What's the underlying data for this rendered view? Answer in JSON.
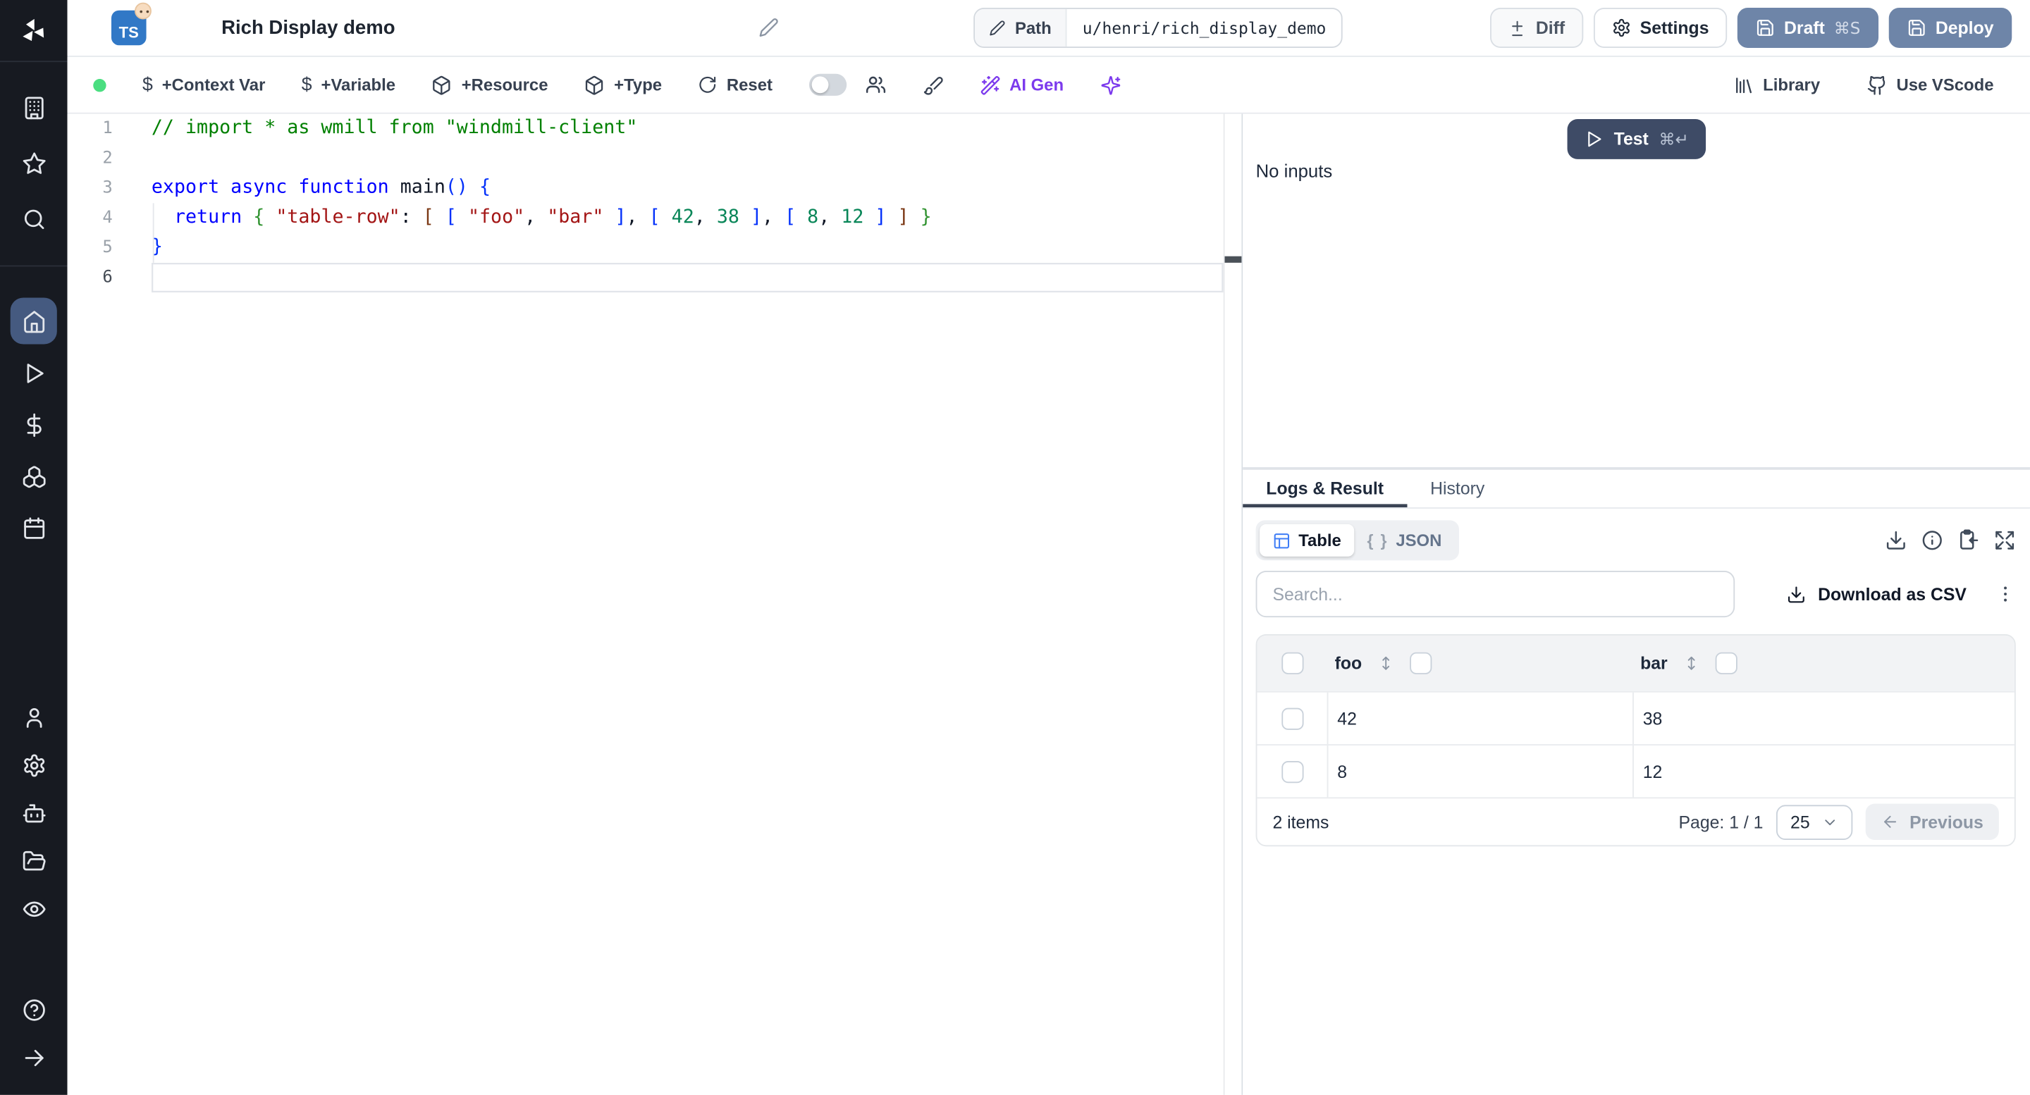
{
  "colors": {
    "sidebar_bg": "#171a21",
    "active_item": "#455a80",
    "primary_button": "#6e85a8",
    "test_button": "#3e4b66",
    "status_dot": "#4ade80",
    "ai_accent": "#7c3aed",
    "ts_badge": "#3178c6",
    "table_icon": "#3f7df6"
  },
  "sidebar": {
    "icons_top": [
      "workspace-building",
      "favorites-star",
      "search"
    ],
    "icons_main": [
      "home",
      "runs-play",
      "variables-dollar",
      "resources-boxes",
      "schedules-calendar"
    ],
    "icons_admin": [
      "user",
      "settings-gear",
      "workers-bot",
      "folders",
      "audit-eye"
    ],
    "icons_bottom": [
      "help-circle",
      "expand-arrow-right"
    ],
    "active": "home"
  },
  "header": {
    "language_badge": "TS",
    "title": "Rich Display demo",
    "path": {
      "label": "Path",
      "value": "u/henri/rich_display_demo"
    },
    "buttons": {
      "diff": "Diff",
      "settings": "Settings",
      "draft": "Draft",
      "draft_kbd": "⌘S",
      "deploy": "Deploy"
    }
  },
  "toolbar": {
    "context_var": "+Context Var",
    "variable": "+Variable",
    "resource": "+Resource",
    "type": "+Type",
    "reset": "Reset",
    "ai_gen": "AI Gen",
    "library": "Library",
    "vscode": "Use VScode"
  },
  "editor": {
    "current_line": 6,
    "lines": [
      {
        "tokens": [
          {
            "t": "// import * as wmill from \"windmill-client\"",
            "c": "comment"
          }
        ]
      },
      {
        "tokens": []
      },
      {
        "tokens": [
          {
            "t": "export",
            "c": "kw"
          },
          {
            "t": " ",
            "c": "pl"
          },
          {
            "t": "async",
            "c": "kw"
          },
          {
            "t": " ",
            "c": "pl"
          },
          {
            "t": "function",
            "c": "kw"
          },
          {
            "t": " ",
            "c": "pl"
          },
          {
            "t": "main",
            "c": "fn"
          },
          {
            "t": "(",
            "c": "b1"
          },
          {
            "t": ")",
            "c": "b1"
          },
          {
            "t": " ",
            "c": "pl"
          },
          {
            "t": "{",
            "c": "b1"
          }
        ]
      },
      {
        "tokens": [
          {
            "t": "  ",
            "c": "pl"
          },
          {
            "t": "return",
            "c": "kw"
          },
          {
            "t": " ",
            "c": "pl"
          },
          {
            "t": "{",
            "c": "b2"
          },
          {
            "t": " ",
            "c": "pl"
          },
          {
            "t": "\"table-row\"",
            "c": "str"
          },
          {
            "t": ": ",
            "c": "pl"
          },
          {
            "t": "[",
            "c": "b3"
          },
          {
            "t": " ",
            "c": "pl"
          },
          {
            "t": "[",
            "c": "b1"
          },
          {
            "t": " ",
            "c": "pl"
          },
          {
            "t": "\"foo\"",
            "c": "str"
          },
          {
            "t": ", ",
            "c": "pl"
          },
          {
            "t": "\"bar\"",
            "c": "str"
          },
          {
            "t": " ",
            "c": "pl"
          },
          {
            "t": "]",
            "c": "b1"
          },
          {
            "t": ", ",
            "c": "pl"
          },
          {
            "t": "[",
            "c": "b1"
          },
          {
            "t": " ",
            "c": "pl"
          },
          {
            "t": "42",
            "c": "num"
          },
          {
            "t": ", ",
            "c": "pl"
          },
          {
            "t": "38",
            "c": "num"
          },
          {
            "t": " ",
            "c": "pl"
          },
          {
            "t": "]",
            "c": "b1"
          },
          {
            "t": ", ",
            "c": "pl"
          },
          {
            "t": "[",
            "c": "b1"
          },
          {
            "t": " ",
            "c": "pl"
          },
          {
            "t": "8",
            "c": "num"
          },
          {
            "t": ", ",
            "c": "pl"
          },
          {
            "t": "12",
            "c": "num"
          },
          {
            "t": " ",
            "c": "pl"
          },
          {
            "t": "]",
            "c": "b1"
          },
          {
            "t": " ",
            "c": "pl"
          },
          {
            "t": "]",
            "c": "b3"
          },
          {
            "t": " ",
            "c": "pl"
          },
          {
            "t": "}",
            "c": "b2"
          }
        ]
      },
      {
        "tokens": [
          {
            "t": "}",
            "c": "b1"
          }
        ]
      },
      {
        "tokens": []
      }
    ]
  },
  "run_panel": {
    "test": "Test",
    "test_kbd": "⌘↵",
    "no_inputs": "No inputs"
  },
  "result_panel": {
    "tabs": [
      "Logs & Result",
      "History"
    ],
    "active_tab": "Logs & Result",
    "view_toggle": {
      "table": "Table",
      "json": "JSON",
      "json_icon": "{ }"
    },
    "action_icons": [
      "download",
      "info",
      "clipboard-paste",
      "expand"
    ],
    "search_placeholder": "Search...",
    "download_csv": "Download as CSV",
    "table": {
      "columns": [
        "foo",
        "bar"
      ],
      "rows": [
        [
          "42",
          "38"
        ],
        [
          "8",
          "12"
        ]
      ]
    },
    "footer": {
      "items": "2 items",
      "page": "Page: 1 / 1",
      "page_size": "25",
      "previous": "Previous"
    }
  }
}
